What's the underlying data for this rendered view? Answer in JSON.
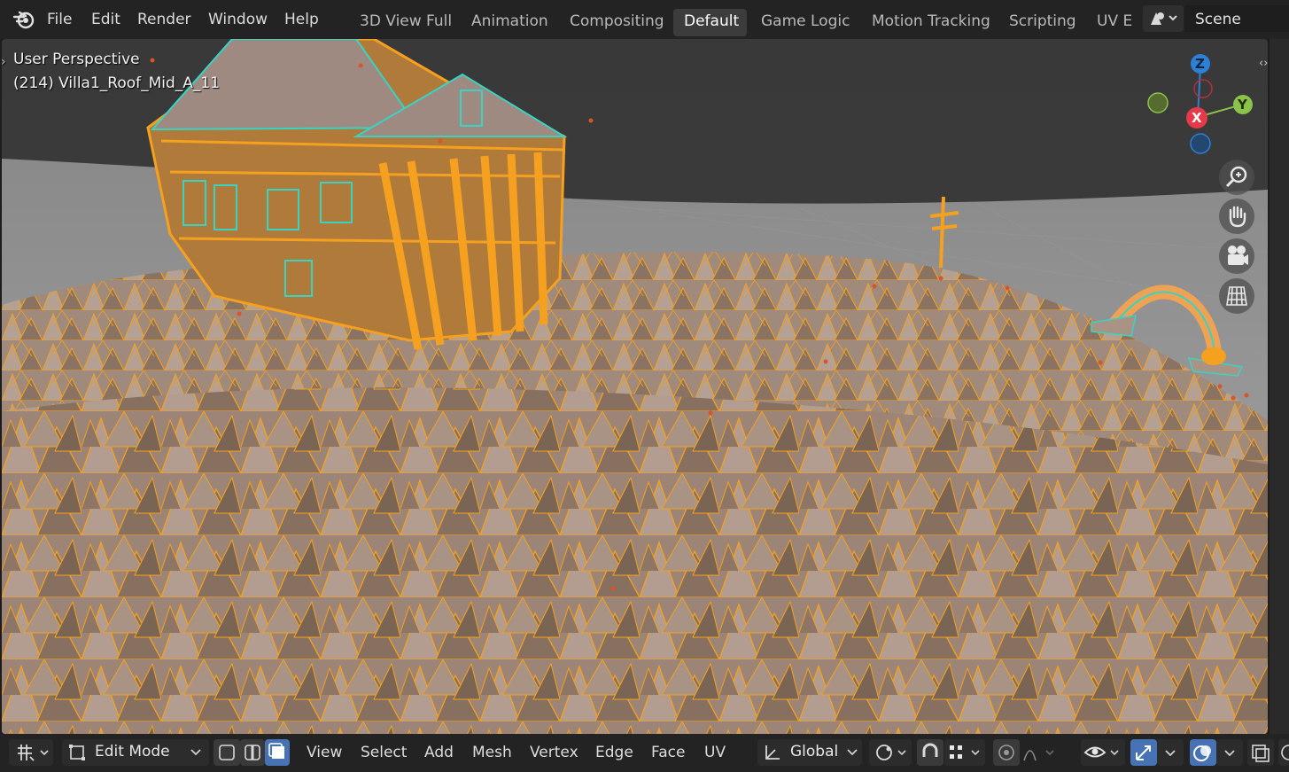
{
  "menu": {
    "items": [
      "File",
      "Edit",
      "Render",
      "Window",
      "Help"
    ]
  },
  "workspaces": {
    "tabs": [
      "3D View Full",
      "Animation",
      "Compositing",
      "Default",
      "Game Logic",
      "Motion Tracking",
      "Scripting",
      "UV E"
    ],
    "active": "Default"
  },
  "scene": {
    "label": "Scene"
  },
  "viewport": {
    "view_name": "User Perspective",
    "object_info": "(214) Villa1_Roof_Mid_A_11"
  },
  "gizmo": {
    "z_label": "Z",
    "y_label": "Y",
    "x_label": "X"
  },
  "navigation": {
    "zoom": "zoom-icon",
    "pan": "hand-icon",
    "camera": "camera-icon",
    "projection": "grid-icon"
  },
  "header": {
    "mode": "Edit Mode",
    "menus": [
      "View",
      "Select",
      "Add",
      "Mesh",
      "Vertex",
      "Edge",
      "Face",
      "UV"
    ],
    "transform_orientation": "Global"
  },
  "colors": {
    "selection_orange": "#f5a01e",
    "mesh_face": "#a48c7f",
    "active_tab": "#3c3c3c",
    "axis_x": "#e8394a",
    "axis_y": "#8bc34a",
    "axis_z": "#2e7fd6"
  }
}
